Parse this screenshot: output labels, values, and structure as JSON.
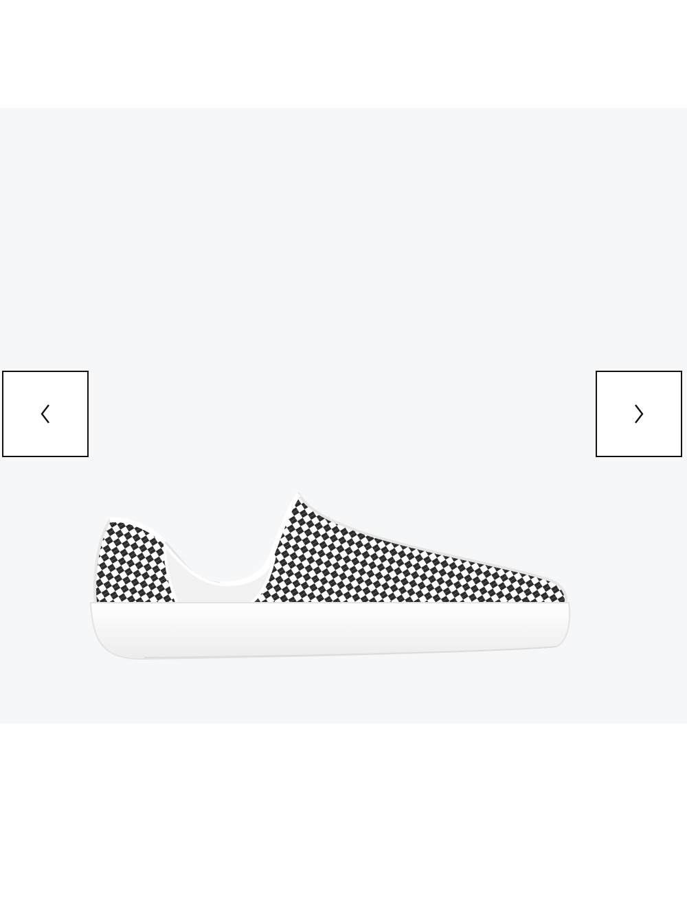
{
  "gallery": {
    "background_color": "#f6f7f9",
    "product_image": {
      "icon": "checkered-slip-on-shoe",
      "colors": {
        "weave_dark": "#2a2a2a",
        "weave_light": "#ffffff",
        "sole": "#ffffff",
        "outline": "#d9d9d9"
      }
    },
    "prev_button": {
      "icon": "chevron-left-icon"
    },
    "next_button": {
      "icon": "chevron-right-icon"
    }
  }
}
